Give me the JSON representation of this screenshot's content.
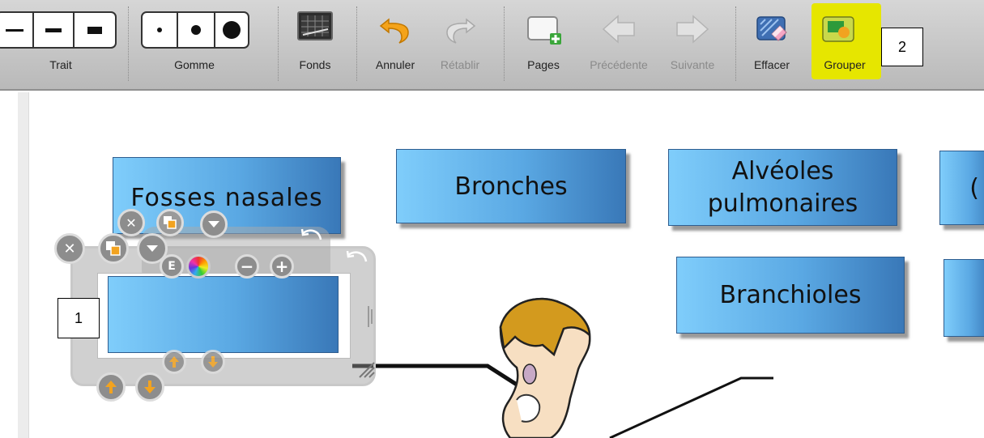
{
  "toolbar": {
    "trait_label": "Trait",
    "gomme_label": "Gomme",
    "fonds_label": "Fonds",
    "annuler_label": "Annuler",
    "retablir_label": "Rétablir",
    "pages_label": "Pages",
    "precedente_label": "Précédente",
    "suivante_label": "Suivante",
    "effacer_label": "Effacer",
    "grouper_label": "Grouper",
    "highlight_color": "#e6e600"
  },
  "cards": {
    "fosses_nasales": "Fosses nasales",
    "bronches": "Bronches",
    "alveoles_line1": "Alvéoles",
    "alveoles_line2": "pulmonaires",
    "branchioles": "Branchioles",
    "partial_right": "("
  },
  "callouts": {
    "one": "1",
    "two": "2"
  },
  "icons": {
    "close": "close-icon",
    "layer": "layer-icon",
    "menu": "chevron-down-icon",
    "color": "color-wheel-icon",
    "minus": "minus-icon",
    "plus": "plus-icon",
    "rotate": "rotate-icon",
    "move_up": "move-up-icon",
    "move_down": "move-down-icon"
  },
  "colors": {
    "card_light": "#7fcdfb",
    "card_dark": "#3978b8",
    "toolbar_bg": "#c8c8c8"
  }
}
